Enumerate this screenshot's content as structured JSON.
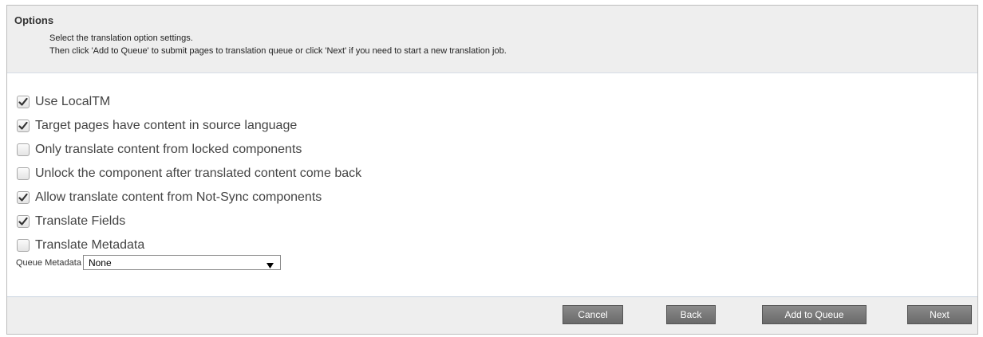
{
  "header": {
    "title": "Options",
    "line1": "Select the translation option settings.",
    "line2": "Then click 'Add to Queue' to submit pages to translation queue or click 'Next' if you need to start a new translation job."
  },
  "options": [
    {
      "label": "Use LocalTM",
      "checked": true
    },
    {
      "label": "Target pages have content in source language",
      "checked": true
    },
    {
      "label": "Only translate content from locked components",
      "checked": false
    },
    {
      "label": "Unlock the component after translated content come back",
      "checked": false
    },
    {
      "label": "Allow translate content from Not-Sync components",
      "checked": true
    },
    {
      "label": "Translate Fields",
      "checked": true
    },
    {
      "label": "Translate Metadata",
      "checked": false
    }
  ],
  "queue": {
    "label": "Queue Metadata",
    "selected": "None",
    "arrow": "▼"
  },
  "buttons": {
    "cancel": "Cancel",
    "back": "Back",
    "add_to_queue": "Add to Queue",
    "next": "Next"
  }
}
